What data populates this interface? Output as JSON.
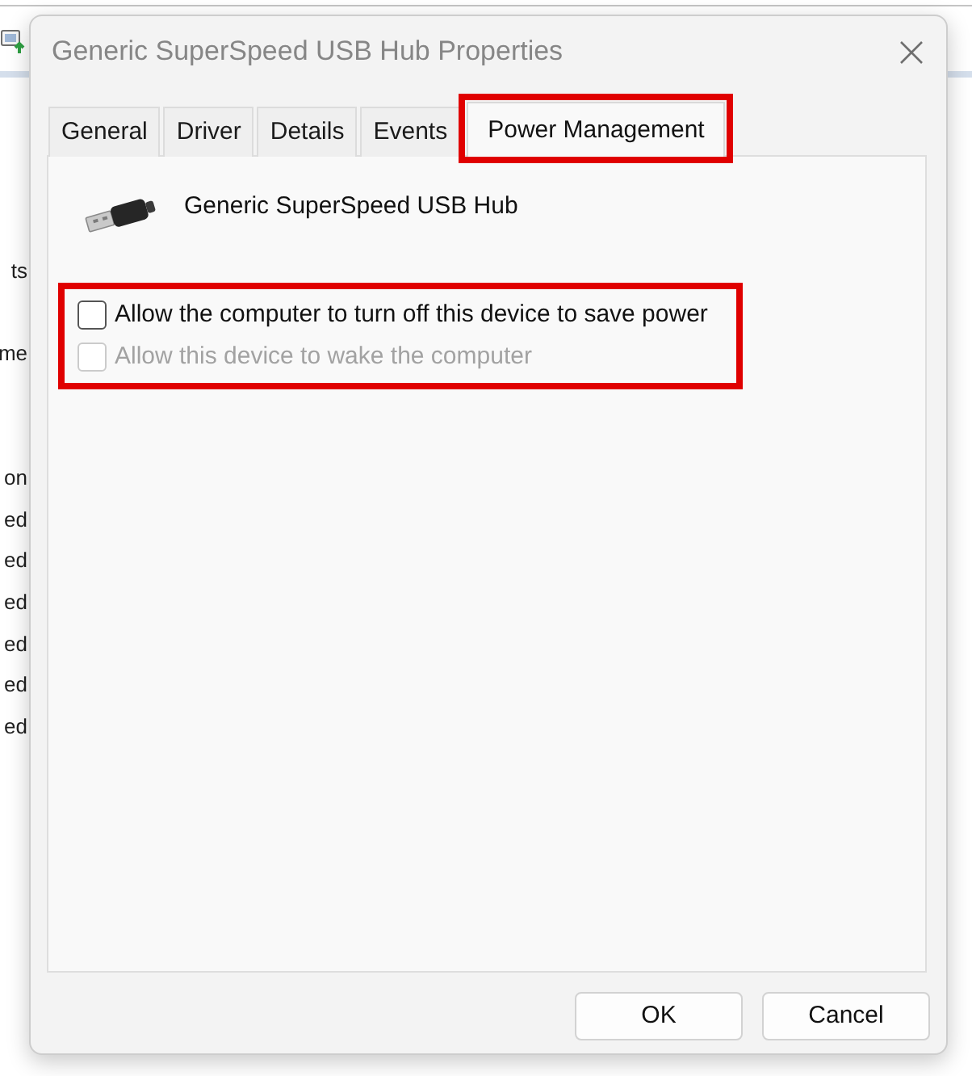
{
  "background_window": {
    "row_groups": [
      {
        "rows": [
          "ts",
          "me"
        ]
      },
      {
        "rows": [
          "on",
          "ed",
          "ed",
          "ed",
          "ed",
          "ed",
          "ed"
        ]
      }
    ]
  },
  "window": {
    "title": "Generic SuperSpeed USB Hub Properties"
  },
  "tabs": [
    {
      "label": "General",
      "selected": false,
      "highlighted": false
    },
    {
      "label": "Driver",
      "selected": false,
      "highlighted": false
    },
    {
      "label": "Details",
      "selected": false,
      "highlighted": false
    },
    {
      "label": "Events",
      "selected": false,
      "highlighted": false
    },
    {
      "label": "Power Management",
      "selected": true,
      "highlighted": true
    }
  ],
  "device": {
    "name": "Generic SuperSpeed USB Hub"
  },
  "options": {
    "highlighted": true,
    "items": [
      {
        "label": "Allow the computer to turn off this device to save power",
        "checked": false,
        "disabled": false
      },
      {
        "label": "Allow this device to wake the computer",
        "checked": false,
        "disabled": true
      }
    ]
  },
  "buttons": [
    {
      "label": "OK"
    },
    {
      "label": "Cancel"
    }
  ]
}
